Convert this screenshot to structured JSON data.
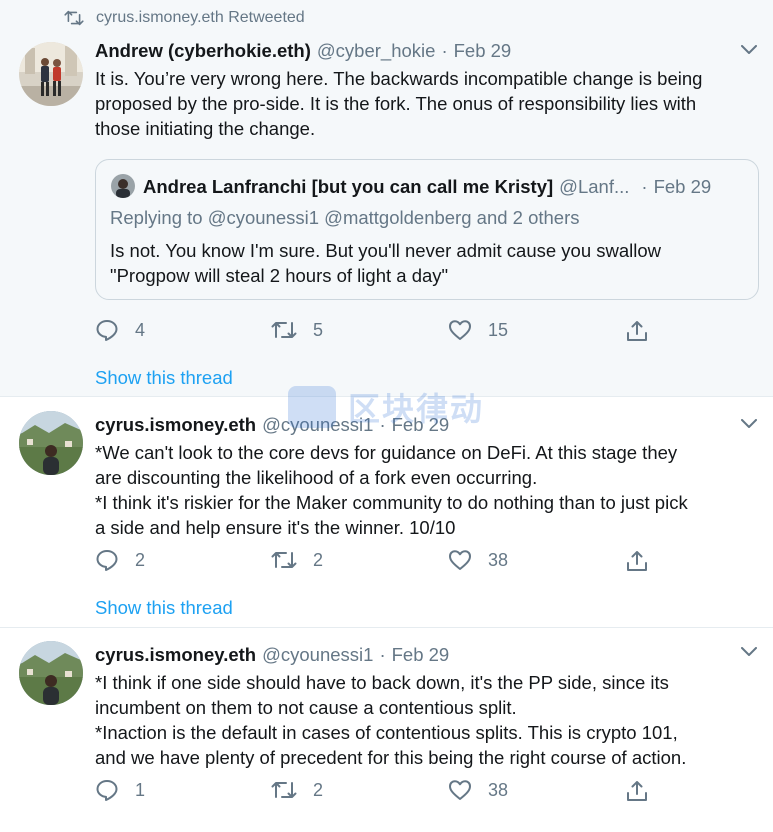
{
  "tweets": [
    {
      "retweet_context": "cyrus.ismoney.eth Retweeted",
      "author_name": "Andrew (cyberhokie.eth)",
      "handle": "@cyber_hokie",
      "separator": "·",
      "date": "Feb 29",
      "lines": [
        "It is. You’re very wrong here. The backwards incompatible change is being",
        "proposed by the pro-side. It is the fork. The onus of responsibility lies with",
        "those initiating the change."
      ],
      "quote": {
        "author_name": "Andrea Lanfranchi [but you can call me Kristy]",
        "handle": "@Lanf...",
        "separator": "·",
        "date": "Feb 29",
        "replying_to": "Replying to @cyounessi1 @mattgoldenberg and 2 others",
        "lines": [
          "Is not. You know I'm sure. But you'll never admit cause you swallow",
          "\"Progpow will steal 2 hours of light a day\""
        ]
      },
      "reply_count": "4",
      "retweet_count": "5",
      "like_count": "15",
      "show_thread": "Show this thread"
    },
    {
      "author_name": "cyrus.ismoney.eth",
      "handle": "@cyounessi1",
      "separator": "·",
      "date": "Feb 29",
      "lines": [
        "*We can't look to the core devs for guidance on DeFi. At this stage they",
        "are discounting the likelihood of a fork even occurring.",
        "*I think it's riskier for the Maker community to do nothing than to just pick",
        "a side and help ensure it's the winner. 10/10"
      ],
      "reply_count": "2",
      "retweet_count": "2",
      "like_count": "38",
      "show_thread": "Show this thread"
    },
    {
      "author_name": "cyrus.ismoney.eth",
      "handle": "@cyounessi1",
      "separator": "·",
      "date": "Feb 29",
      "lines": [
        "*I think if one side should have to back down, it's the PP side, since its",
        "incumbent on them to not cause a contentious split.",
        "*Inaction is the default in cases of contentious splits. This is crypto 101,",
        "and we have plenty of precedent for this being the right course of action."
      ],
      "reply_count": "1",
      "retweet_count": "2",
      "like_count": "38"
    }
  ],
  "watermark": {
    "text": "区块律动"
  },
  "colors": {
    "link": "#1da1f2",
    "secondary_text": "#657786",
    "primary_text": "#14171a",
    "highlight_bg": "#f5f8fa"
  },
  "icons": [
    "retweet-icon",
    "caret-down-icon",
    "reply-icon",
    "like-icon",
    "share-icon"
  ]
}
